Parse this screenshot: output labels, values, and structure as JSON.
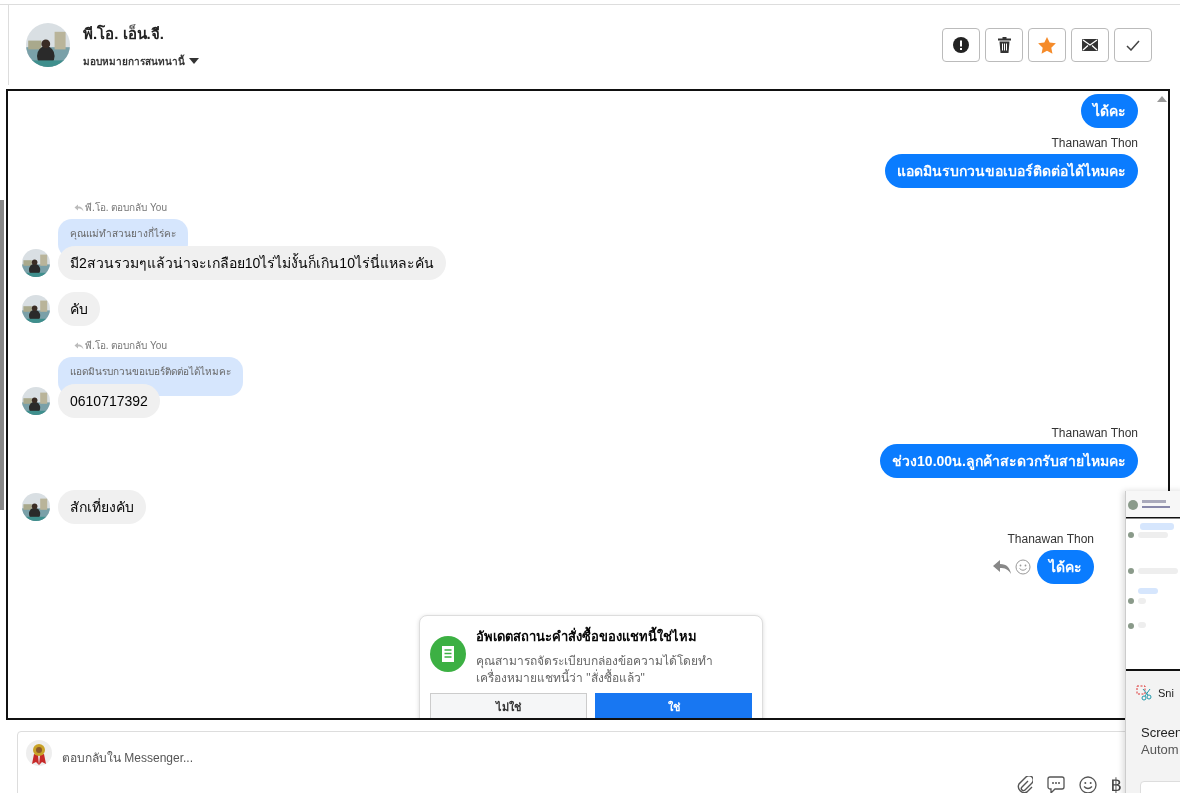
{
  "header": {
    "name": "พี.โอ. เอ็น.จี.",
    "assign_label": "มอบหมายการสนทนานี้",
    "starred": true
  },
  "messages": [
    {
      "kind": "out",
      "text": "ได้คะ"
    },
    {
      "kind": "out",
      "sender": "Thanawan Thon",
      "text": "แอดมินรบกวนขอเบอร์ติดต่อได้ไหมคะ"
    },
    {
      "kind": "in",
      "reply_label": "พี.โอ. ตอบกลับ You",
      "quote": "คุณแม่ทำสวนยางกี่ไร่คะ",
      "text": "มี2สวนรวมๆแล้วน่าจะเกลือย10ไร่ไม่งั้นก็เกิน10ไร่นี่แหละคัน"
    },
    {
      "kind": "in",
      "text": "คับ"
    },
    {
      "kind": "in",
      "reply_label": "พี.โอ. ตอบกลับ You",
      "quote": "แอดมินรบกวนขอเบอร์ติดต่อได้ไหมคะ",
      "text": "0610717392"
    },
    {
      "kind": "out",
      "sender": "Thanawan Thon",
      "text": "ช่วง10.00น.ลูกค้าสะดวกรับสายไหมคะ"
    },
    {
      "kind": "in",
      "text": "สักเที่ยงคับ"
    },
    {
      "kind": "out",
      "sender": "Thanawan Thon",
      "text": "ได้คะ",
      "hover_actions": true
    }
  ],
  "prompt": {
    "title": "อัพเดตสถานะคำสั่งซื้อของแชทนี้ใช่ไหม",
    "body": "คุณสามารถจัดระเบียบกล่องข้อความได้โดยทำเครื่องหมายแชทนี้ว่า \"สั่งซื้อแล้ว\"",
    "buttons": [
      {
        "label": "ไม่ใช่",
        "kind": "secondary"
      },
      {
        "label": "ใช่",
        "kind": "primary"
      }
    ]
  },
  "composer": {
    "placeholder": "ตอบกลับใน Messenger...",
    "currency_symbol": "฿"
  },
  "snip_notification": {
    "app": "Sni",
    "title": "Screen",
    "subtitle": "Autom"
  }
}
